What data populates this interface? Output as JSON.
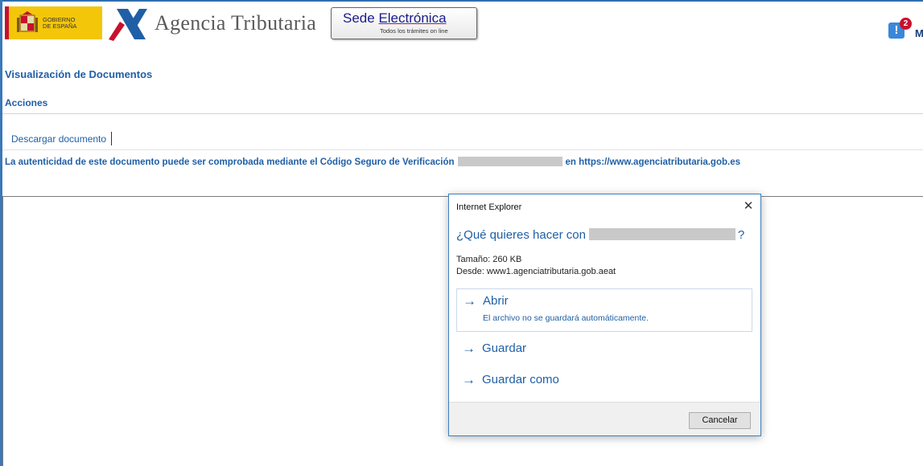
{
  "header": {
    "gobierno_line1": "GOBIERNO",
    "gobierno_line2": "DE ESPAÑA",
    "agency_name": "Agencia Tributaria",
    "sede_title_part1": "Sede ",
    "sede_title_part2": "Electrónica",
    "sede_subtitle": "Todos los trámites on line",
    "notification_count": "2",
    "notification_icon_char": "!",
    "notification_letter": "M"
  },
  "page": {
    "title": "Visualización de Documentos",
    "actions_label": "Acciones",
    "download_link": "Descargar documento",
    "csv_prefix": "La autenticidad de este documento puede ser comprobada mediante el Código Seguro de Verificación",
    "csv_suffix": "en https://www.agenciatributaria.gob.es"
  },
  "dialog": {
    "title": "Internet Explorer",
    "close_symbol": "✕",
    "question_prefix": "¿Qué quieres hacer con",
    "question_suffix": "?",
    "size_text": "Tamaño: 260 KB",
    "from_text": "Desde: www1.agenciatributaria.gob.aeat",
    "options": [
      {
        "label": "Abrir",
        "sub": "El archivo no se guardará automáticamente."
      },
      {
        "label": "Guardar"
      },
      {
        "label": "Guardar como"
      }
    ],
    "arrow_symbol": "→",
    "cancel_label": "Cancelar"
  },
  "colors": {
    "link_blue": "#1f5fa6",
    "accent_border": "#3c7fc4",
    "gob_yellow": "#f3c60a",
    "gob_red": "#c8102e"
  }
}
